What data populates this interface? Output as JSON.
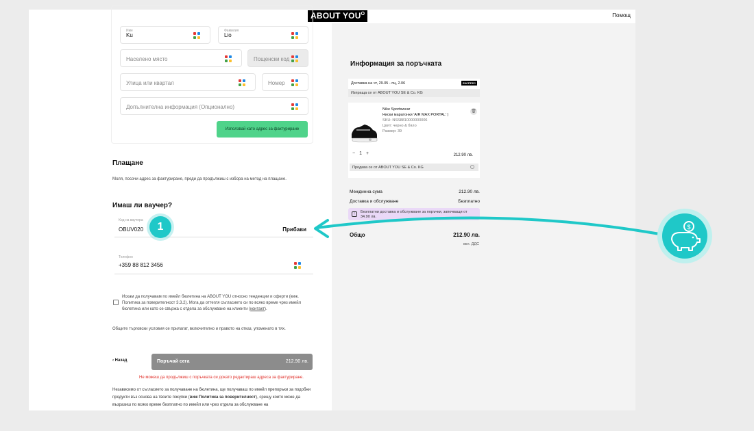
{
  "header": {
    "logo": "ABOUT YOU",
    "logo_mark": "O",
    "help": "Помощ"
  },
  "address_form": {
    "first_name": {
      "label": "Име",
      "value": "Ku"
    },
    "last_name": {
      "label": "Фамилия",
      "value": "Lio"
    },
    "city_placeholder": "Населено място",
    "postal_placeholder": "Пощенски код",
    "street_placeholder": "Улица или квартал",
    "number_placeholder": "Номер",
    "extra_placeholder": "Допълнителна информация (Опционално)",
    "use_billing_button": "Използвай като адрес за фактуриране"
  },
  "payment": {
    "title": "Плащане",
    "note": "Моля, посочи адрес за фактуриране, преди да продължиш с избора на метод на плащане."
  },
  "voucher": {
    "title": "Имаш ли ваучер?",
    "label": "Код на ваучера",
    "value": "OBUV020",
    "add_button": "Прибави",
    "step_badge": "1"
  },
  "phone": {
    "label": "Телефон",
    "value": "+359 88 812 3456"
  },
  "newsletter": {
    "text_1": "Искам да получавам по имейл бюлетина на ABOUT YOU относно тенденции и оферти (виж. Политика за поверителност 3.3.2). Мога да оттегля съгласието си по всяко време чрез имейл бюлетина или като се свържа с отдела за обслужване на клиенти (",
    "link": "контакт",
    "text_2": ")."
  },
  "terms_note": "Общите търговски условия се прилагат, включително и правото на отказ, упоменато в тях.",
  "actions": {
    "back": "Назад",
    "order_button": "Поръчай сега",
    "order_total": "212.90 лв."
  },
  "error": "Не можеш да продължиш с поръчката си докато редактираш адреса за фактуриране.",
  "legal": {
    "part1": "Независимо от съгласието за получаване на бюлетина, ще получаваш по имейл препоръки за подобни продукти въз основа на твоите покупки (",
    "bold": "виж Политика за поверителност",
    "part2": "), срещу които може да възразиш по всяко време безплатно по имейл или чрез отдела за обслужване на"
  },
  "order_info": {
    "title": "Информация за поръчката",
    "delivery": "Доставка на чт, 29.05 - пц, 2.06",
    "delivery_badge": "ЕКСПРЕС",
    "shipped_by": "Изпраща се от ABOUT YOU SE & Co. KG",
    "product": {
      "brand": "Nike Sportswear",
      "name": "Ниски маратонки 'AIR MAX PORTAL' )",
      "sku": "SKU: NSS8810000000006",
      "color": "Цвят: черно & бяло",
      "size": "Размер: 39",
      "qty": "1",
      "price": "212.90 лв."
    },
    "sold_by": "Продава се от ABOUT YOU SE & Co. KG",
    "subtotal_label": "Междинна сума",
    "subtotal_value": "212.90 лв.",
    "shipping_label": "Доставка и обслужване",
    "shipping_value": "Безплатно",
    "promo": "Безплатни доставка и обслужване за поръчки, започващи от 34.90 лв.",
    "total_label": "Общо",
    "total_value": "212.90 лв.",
    "vat_note": "вкл. ДДС"
  },
  "colors": {
    "accent_teal": "#1fc8c8",
    "green_button": "#4fd38a",
    "error_red": "#e0302a",
    "promo_purple": "#ead9f7"
  },
  "icons": [
    "google-multicolor-icon",
    "trash-icon",
    "info-icon",
    "piggy-bank-icon",
    "chevron-left-icon"
  ]
}
